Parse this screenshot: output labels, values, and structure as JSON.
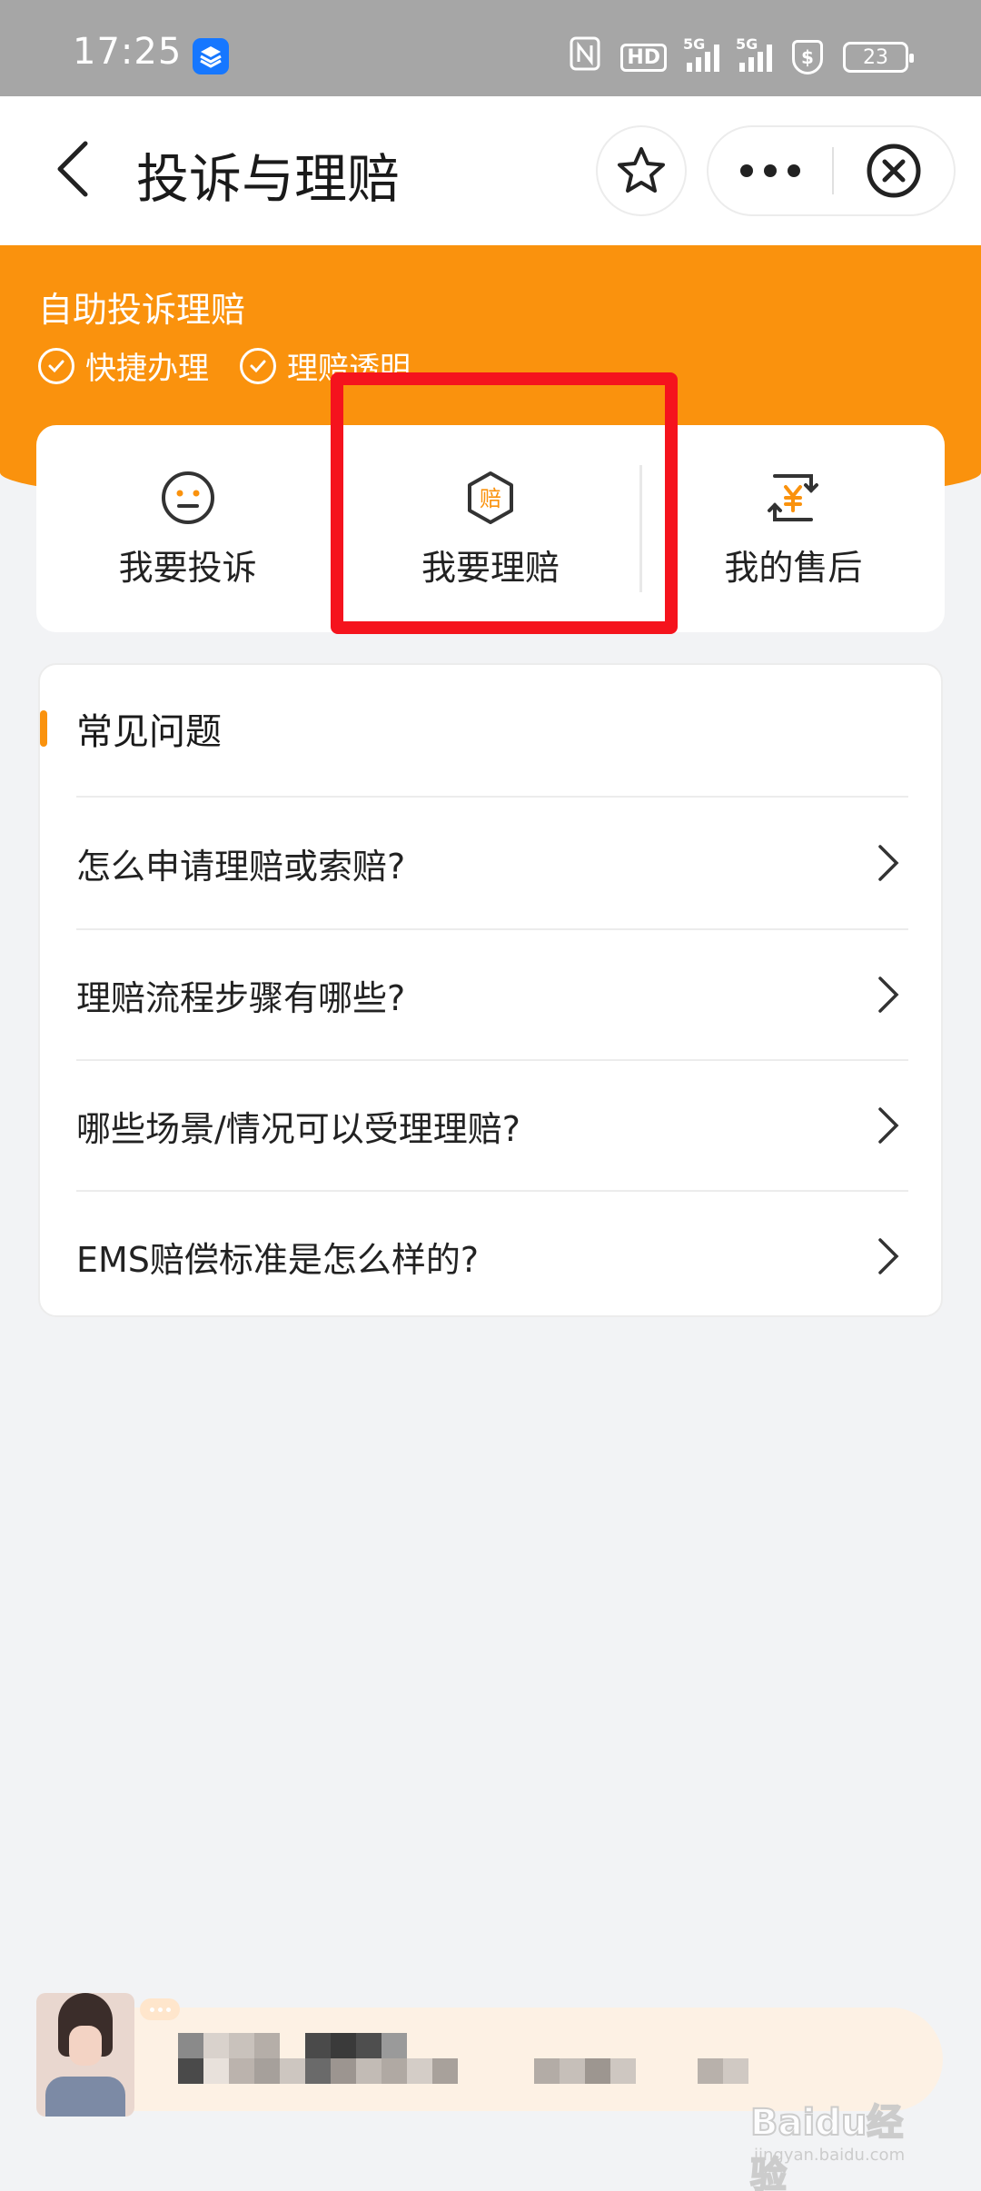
{
  "status_bar": {
    "time": "17:25",
    "hd_label": "HD",
    "network_1": "5G",
    "network_2": "5G",
    "battery": "23",
    "icons": [
      "app-icon",
      "nfc-icon",
      "hd-icon",
      "signal-5g-icon",
      "signal-5g-icon",
      "shield-icon",
      "battery-icon"
    ]
  },
  "nav": {
    "title": "投诉与理赔",
    "icons": [
      "back-arrow-icon",
      "star-icon",
      "more-icon",
      "close-circle-icon"
    ]
  },
  "banner": {
    "title": "自助投诉理赔",
    "tags": [
      "快捷办理",
      "理赔透明"
    ]
  },
  "actions": [
    {
      "label": "我要投诉",
      "icon": "neutral-face-icon"
    },
    {
      "label": "我要理赔",
      "icon": "compensation-hexagon-icon",
      "icon_text": "赔"
    },
    {
      "label": "我的售后",
      "icon": "yuan-exchange-icon"
    }
  ],
  "faq": {
    "title": "常见问题",
    "items": [
      "怎么申请理赔或索赔?",
      "理赔流程步骤有哪些?",
      "哪些场景/情况可以受理理赔?",
      "EMS赔偿标准是怎么样的?"
    ]
  },
  "watermark": {
    "brand": "Baidu经验",
    "url": "jingyan.baidu.com"
  },
  "colors": {
    "accent_orange": "#fa920d",
    "highlight_red": "#f5131d",
    "page_bg": "#f2f3f5"
  }
}
